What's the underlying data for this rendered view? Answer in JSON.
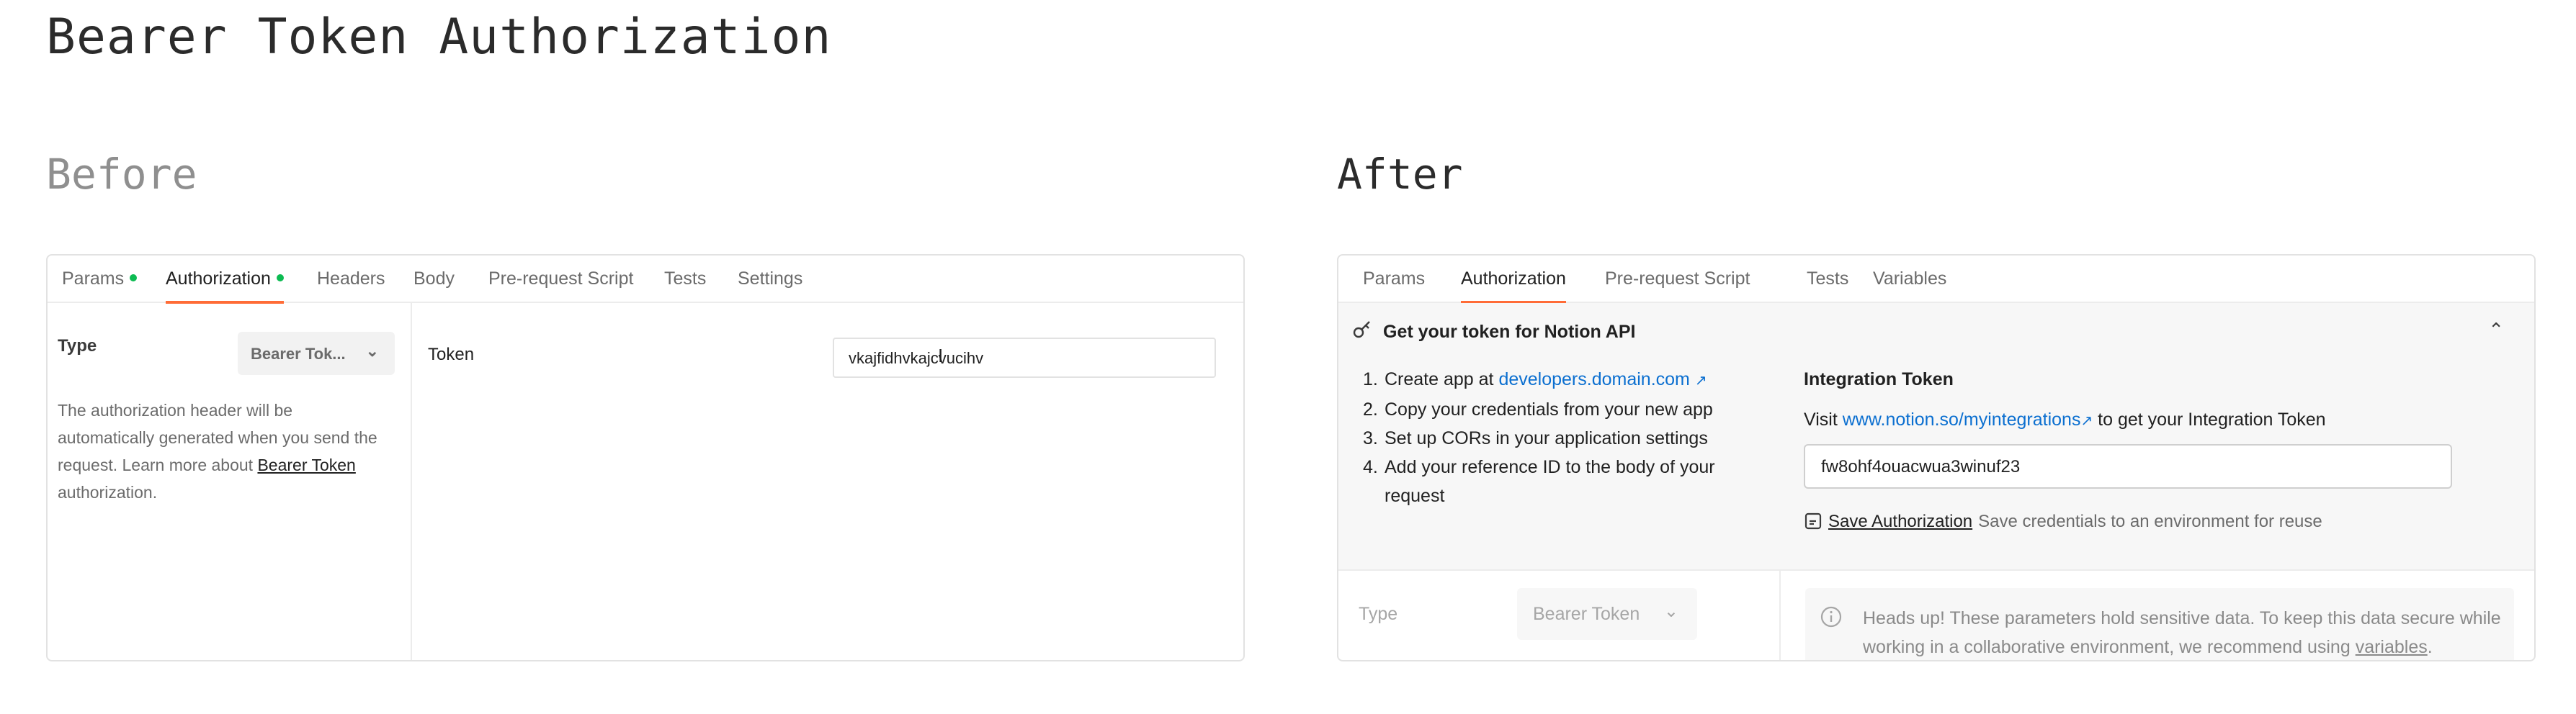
{
  "page_title": "Bearer Token Authorization",
  "before": {
    "heading": "Before",
    "tabs": [
      {
        "label": "Params",
        "dot": true
      },
      {
        "label": "Authorization",
        "dot": true,
        "active": true
      },
      {
        "label": "Headers"
      },
      {
        "label": "Body"
      },
      {
        "label": "Pre-request Script"
      },
      {
        "label": "Tests"
      },
      {
        "label": "Settings"
      }
    ],
    "type_label": "Type",
    "type_value": "Bearer Tok...",
    "description_1": "The authorization header will be automatically generated when you send the request. Learn more about",
    "description_link": "Bearer Token",
    "description_2": "authorization.",
    "token_label": "Token",
    "token_value": "vkajfidhvkajcvucihv"
  },
  "after": {
    "heading": "After",
    "tabs": [
      {
        "label": "Params"
      },
      {
        "label": "Authorization",
        "active": true
      },
      {
        "label": "Pre-request Script"
      },
      {
        "label": "Tests"
      },
      {
        "label": "Variables"
      }
    ],
    "section_heading": "Get your token for Notion API",
    "steps": {
      "step1_text": "Create app at",
      "step1_link": "developers.domain.com",
      "step2": "Copy your credentials from your new app",
      "step3": "Set up CORs in your application settings",
      "step4": "Add your reference ID to the body of your request"
    },
    "integration_title": "Integration Token",
    "visit_prefix": "Visit",
    "visit_link": "www.notion.so/myintegrations",
    "visit_suffix": "to get your Integration Token",
    "integration_token_value": "fw8ohf4ouacwua3winuf23",
    "save_label": "Save Authorization",
    "save_hint": "Save credentials to an environment for reuse",
    "type_label": "Type",
    "type_value": "Bearer Token",
    "notice_text": "Heads up! These parameters hold sensitive data. To keep this data secure while working in a collaborative environment, we recommend using",
    "notice_link": "variables",
    "notice_end": "."
  },
  "colors": {
    "accent": "#ff6c37",
    "status_dot": "#0cbb52",
    "link": "#0b6fd0"
  }
}
